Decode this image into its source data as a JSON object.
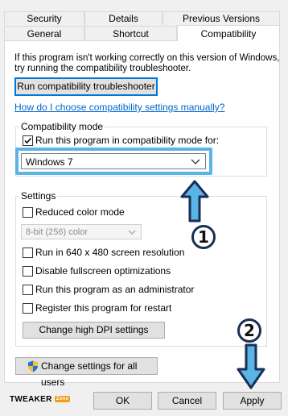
{
  "tabs": {
    "row1": [
      "Security",
      "Details",
      "Previous Versions"
    ],
    "row2": [
      "General",
      "Shortcut",
      "Compatibility"
    ]
  },
  "intro_text_line1": "If this program isn't working correctly on this version of Windows,",
  "intro_text_line2": "try running the compatibility troubleshooter.",
  "troubleshooter_button": "Run compatibility troubleshooter",
  "manual_link": "How do I choose compatibility settings manually?",
  "compat_mode": {
    "group_title": "Compatibility mode",
    "checkbox_label": "Run this program in compatibility mode for:",
    "checked": true,
    "selected_os": "Windows 7"
  },
  "settings": {
    "group_title": "Settings",
    "reduced_color_label": "Reduced color mode",
    "color_option": "8-bit (256) color",
    "res_label": "Run in 640 x 480 screen resolution",
    "fullscreen_label": "Disable fullscreen optimizations",
    "admin_label": "Run this program as an administrator",
    "restart_label": "Register this program for restart",
    "dpi_button": "Change high DPI settings"
  },
  "all_users_button": "Change settings for all users",
  "footer": {
    "logo_text": "TWEAKER",
    "logo_badge": "Zone",
    "ok": "OK",
    "cancel": "Cancel",
    "apply": "Apply"
  },
  "annotations": {
    "step1": "1",
    "step2": "2"
  },
  "colors": {
    "highlight": "#5ab4e6",
    "link": "#0066cc",
    "button_border_focus": "#0078d7"
  }
}
